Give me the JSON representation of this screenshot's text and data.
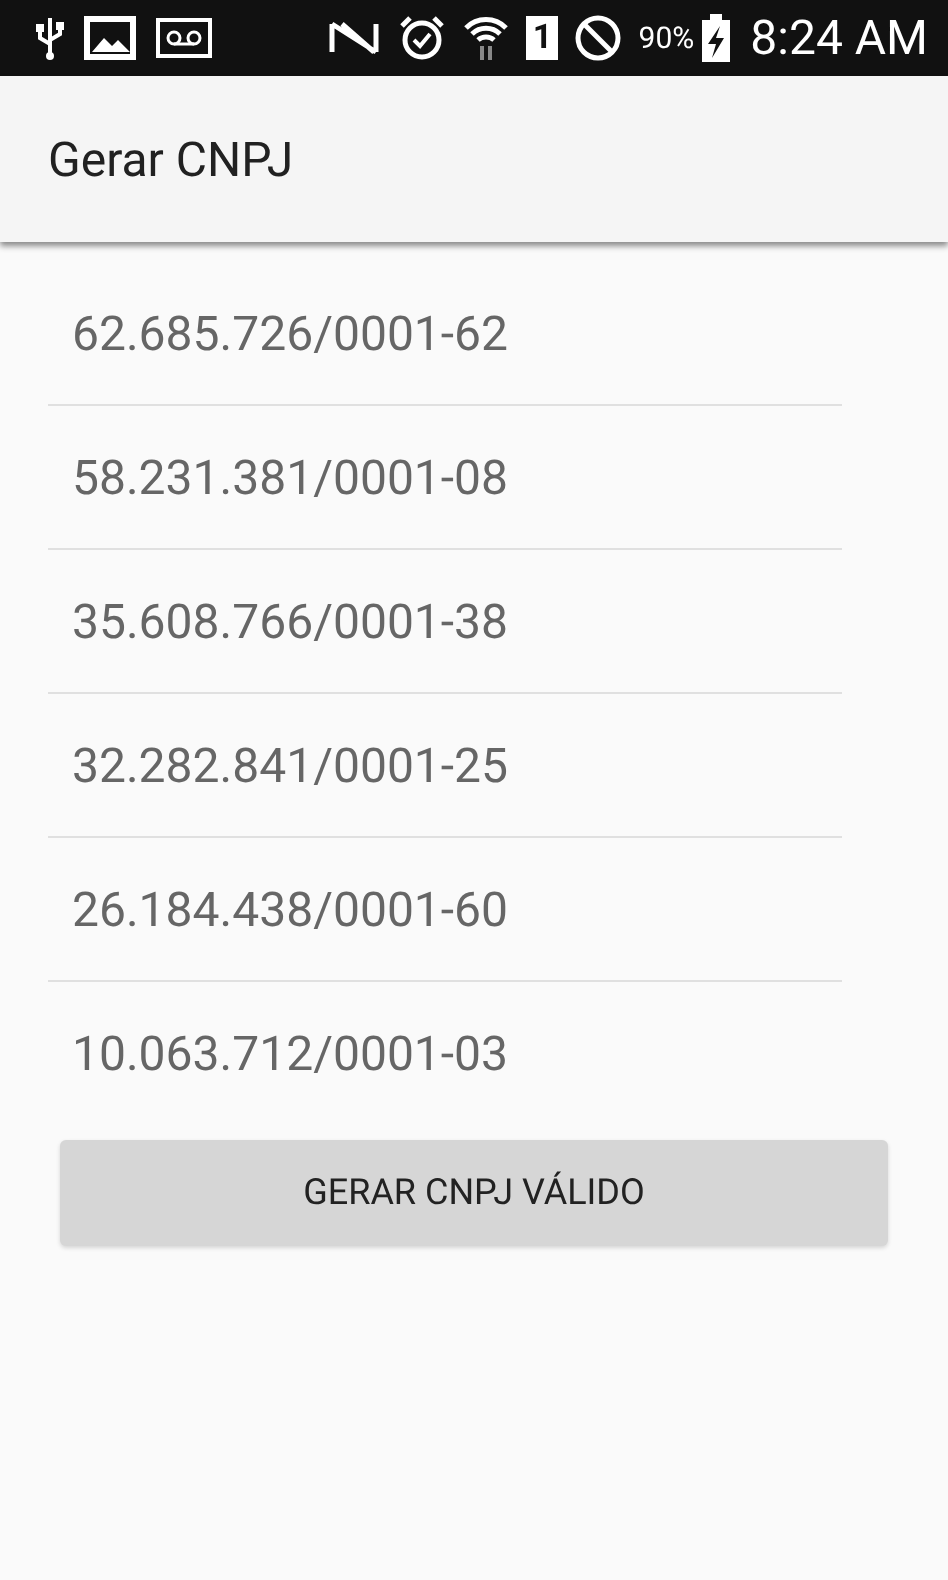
{
  "status_bar": {
    "sim_slot": "1",
    "battery": "90%",
    "time": "8:24 AM"
  },
  "app_bar": {
    "title": "Gerar CNPJ"
  },
  "cnpj_list": [
    "62.685.726/0001-62",
    "58.231.381/0001-08",
    "35.608.766/0001-38",
    "32.282.841/0001-25",
    "26.184.438/0001-60",
    "10.063.712/0001-03"
  ],
  "button": {
    "label": "GERAR CNPJ VÁLIDO"
  }
}
